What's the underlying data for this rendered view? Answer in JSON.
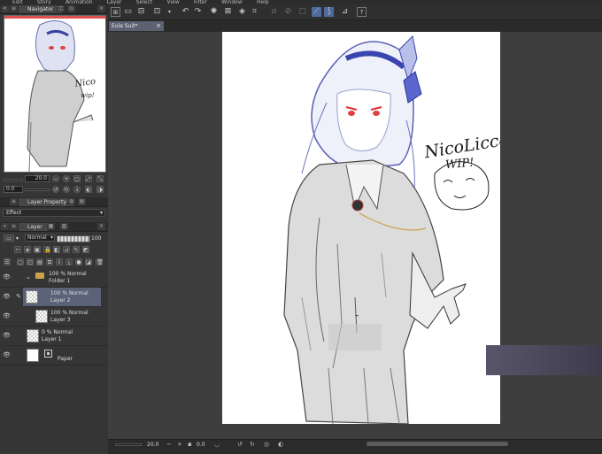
{
  "menu": {
    "items": [
      "Edit",
      "Story",
      "Animation",
      "Layer",
      "Select",
      "View",
      "Filter",
      "Window",
      "Help"
    ]
  },
  "navigator": {
    "tab_label": "Navigator",
    "zoom_value": "20.0",
    "angle_value": "0.0"
  },
  "layer_property": {
    "tab_label": "Layer Property",
    "effect_label": "Effect"
  },
  "layer_panel": {
    "tab_label": "Layer",
    "blend_mode": "Normal",
    "opacity": "100",
    "layers": [
      {
        "line1": "100 % Normal",
        "line2": "Folder 1"
      },
      {
        "line1": "100 % Normal",
        "line2": "Layer 2"
      },
      {
        "line1": "100 % Normal",
        "line2": "Layer 3"
      },
      {
        "line1": "0 % Normal",
        "line2": "Layer 1"
      },
      {
        "line1": "",
        "line2": "Paper"
      }
    ]
  },
  "document": {
    "tab_label": "Eula Suit*",
    "close_glyph": "×"
  },
  "artwork": {
    "handwritten_line1": "NicoLicca",
    "handwritten_line2": "WIP!"
  },
  "status": {
    "zoom_value": "20.0",
    "angle_value": "0.0"
  },
  "icons": [
    "hand-icon",
    "zoom-in-icon",
    "zoom-out-icon",
    "undo-icon",
    "redo-icon",
    "eye-icon",
    "pen-icon",
    "folder-icon",
    "lock-icon",
    "trash-icon",
    "help-icon"
  ],
  "colors": {
    "selection": "#5a6277",
    "panel": "#353535",
    "canvas_bg": "#3e3e3e",
    "accent": "#4d6a9a"
  }
}
